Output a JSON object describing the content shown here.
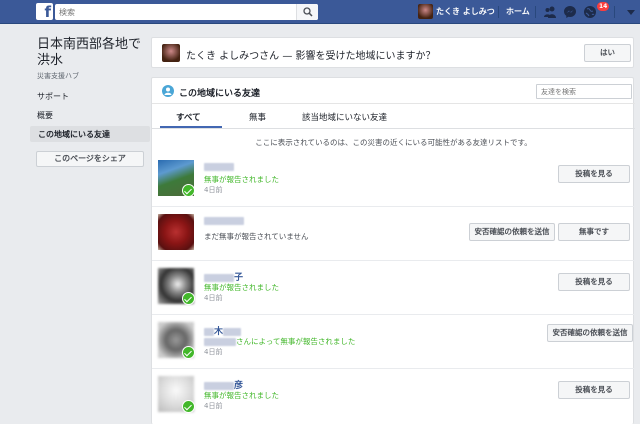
{
  "topbar": {
    "logo": "f",
    "search_placeholder": "検索",
    "user_name": "たくき よしみつ",
    "home_label": "ホーム",
    "notification_count": "14",
    "icons": [
      "friends-icon",
      "messenger-icon",
      "globe-icon",
      "chevron-down-icon"
    ]
  },
  "sidebar": {
    "title": "日本南西部各地で洪水",
    "subtitle": "災害支援ハブ",
    "items": [
      {
        "label": "サポート"
      },
      {
        "label": "概要"
      },
      {
        "label": "この地域にいる友達",
        "active": true
      }
    ],
    "share_button": "このページをシェア"
  },
  "question": {
    "text": "たくき よしみつさん — 影響を受けた地域にいますか？",
    "yes_button": "はい"
  },
  "friends": {
    "title": "この地域にいる友達",
    "search_placeholder": "友達を検索",
    "tabs": [
      {
        "label": "すべて",
        "active": true
      },
      {
        "label": "無事"
      },
      {
        "label": "該当地域にいない友達"
      }
    ],
    "info": "ここに表示されているのは、この災害の近くにいる可能性がある友達リストです。",
    "rows": [
      {
        "name": "",
        "status": "無事が報告されました",
        "time": "4日前",
        "safe": true,
        "buttons": [
          "投稿を見る"
        ]
      },
      {
        "name": "",
        "status": "まだ無事が報告されていません",
        "time": "",
        "safe": false,
        "buttons": [
          "安否確認の依頼を送信",
          "無事です"
        ]
      },
      {
        "name": "子",
        "status": "無事が報告されました",
        "time": "4日前",
        "safe": true,
        "buttons": [
          "投稿を見る"
        ]
      },
      {
        "name": "木",
        "status": "さんによって無事が報告されました",
        "time": "4日前",
        "safe": true,
        "buttons": [
          "安否確認の依頼を送信"
        ]
      },
      {
        "name": "彦",
        "status": "無事が報告されました",
        "time": "4日前",
        "safe": true,
        "buttons": [
          "投稿を見る"
        ]
      }
    ]
  },
  "colors": {
    "brand": "#3b5998",
    "link": "#365899",
    "safe_green": "#42b72a",
    "badge_red": "#fa3e3e"
  }
}
